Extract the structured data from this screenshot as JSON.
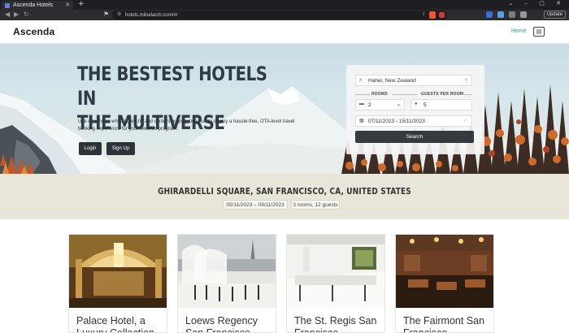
{
  "browser": {
    "tab_title": "Ascenda Hotels",
    "tab_close": "✕",
    "new_tab": "+",
    "url": "hotels.milselarch.com/#/",
    "update_label": "Update",
    "window_controls": "⌄ – ▢ ✕"
  },
  "site": {
    "logo": "Ascenda",
    "nav_home": "Home"
  },
  "hero": {
    "title_line1": "THE BESTEST HOTELS IN",
    "title_line2": "THE MULTIVERSE",
    "description": "Use Ascenda's white label UIs and content aggregation hub to deploy a hassle-free, OTA-level travel booking experience for your rewards program.",
    "login_label": "Login",
    "signup_label": "Sign Up"
  },
  "search": {
    "destination": "Hahei, New Zealand",
    "rooms_label": "ROOMS",
    "guests_label": "GUESTS PER ROOM",
    "rooms_value": "2",
    "guests_value": "5",
    "dates": "07/11/2023 - 15/11/2023",
    "search_label": "Search"
  },
  "destination": {
    "title": "GHIRARDELLI SQUARE, SAN FRANCISCO, CA, UNITED STATES",
    "dates": "05/11/2023 – 09/11/2023",
    "rooms_guests": "3 rooms, 12 guests"
  },
  "hotels": [
    {
      "name": "Palace Hotel, a Luxury Collection"
    },
    {
      "name": "Loews Regency San Francisco"
    },
    {
      "name": "The St. Regis San Francisco"
    },
    {
      "name": "The Fairmont San Francisco"
    }
  ],
  "colors": {
    "accent": "#2ba58f",
    "button_dark": "#343a40",
    "strip_bg": "#e8e5d9"
  },
  "icons": {
    "back": "back-arrow-icon",
    "forward": "forward-arrow-icon",
    "reload": "reload-icon",
    "bookmark": "bookmark-icon",
    "share": "share-icon",
    "brave": "brave-shield-icon",
    "profile": "profile-card-icon",
    "search": "search-icon",
    "clear": "clear-icon",
    "rooms": "bed-icon",
    "guests": "person-icon",
    "calendar": "calendar-icon",
    "check": "check-icon"
  }
}
